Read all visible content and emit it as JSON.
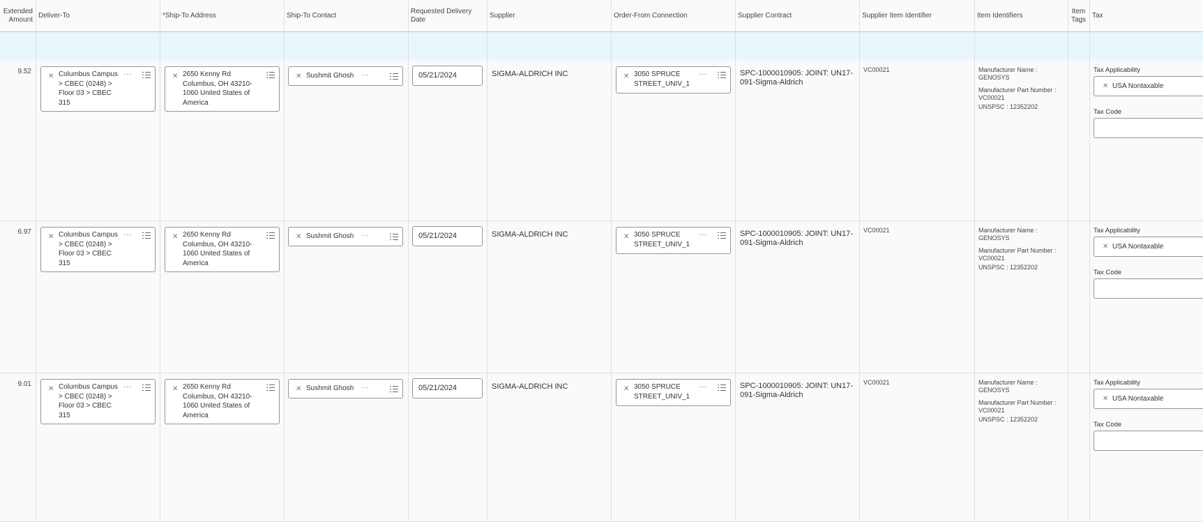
{
  "headers": {
    "extended_amount": "Extended Amount",
    "deliver_to": "Deliver-To",
    "ship_to_address": "*Ship-To Address",
    "ship_to_contact": "Ship-To Contact",
    "requested_delivery_date": "Requested Delivery Date",
    "supplier": "Supplier",
    "order_from_connection": "Order-From Connection",
    "supplier_contract": "Supplier Contract",
    "supplier_item_identifier": "Supplier Item Identifier",
    "item_identifiers": "Item Identifiers",
    "item_tags": "Item Tags",
    "tax": "Tax"
  },
  "rows": [
    {
      "amount": "9.52",
      "deliver_to": "Columbus Campus > CBEC (0248) > Floor 03 > CBEC 315",
      "ship_to_address": "2650 Kenny Rd Columbus, OH 43210-1060 United States of America",
      "ship_to_contact": "Sushmit Ghosh",
      "delivery_date": "05/21/2024",
      "supplier": "SIGMA-ALDRICH INC",
      "order_from": "3050 SPRUCE STREET_UNIV_1",
      "contract": "SPC-1000010905: JOINT: UN17-091-Sigma-Aldrich",
      "supplier_item_id": "VC00021",
      "mfr_name": "Manufacturer Name : GENOSYS",
      "mfr_part": "Manufacturer Part Number : VC00021",
      "unspsc": "UNSPSC : 12352202",
      "tax_applicability_label": "Tax Applicability",
      "tax_applicability": "USA Nontaxable",
      "tax_code_label": "Tax Code"
    },
    {
      "amount": "6.97",
      "deliver_to": "Columbus Campus > CBEC (0248) > Floor 03 > CBEC 315",
      "ship_to_address": "2650 Kenny Rd Columbus, OH 43210-1060 United States of America",
      "ship_to_contact": "Sushmit Ghosh",
      "delivery_date": "05/21/2024",
      "supplier": "SIGMA-ALDRICH INC",
      "order_from": "3050 SPRUCE STREET_UNIV_1",
      "contract": "SPC-1000010905: JOINT: UN17-091-Sigma-Aldrich",
      "supplier_item_id": "VC00021",
      "mfr_name": "Manufacturer Name : GENOSYS",
      "mfr_part": "Manufacturer Part Number : VC00021",
      "unspsc": "UNSPSC : 12352202",
      "tax_applicability_label": "Tax Applicability",
      "tax_applicability": "USA Nontaxable",
      "tax_code_label": "Tax Code"
    },
    {
      "amount": "9.01",
      "deliver_to": "Columbus Campus > CBEC (0248) > Floor 03 > CBEC 315",
      "ship_to_address": "2650 Kenny Rd Columbus, OH 43210-1060 United States of America",
      "ship_to_contact": "Sushmit Ghosh",
      "delivery_date": "05/21/2024",
      "supplier": "SIGMA-ALDRICH INC",
      "order_from": "3050 SPRUCE STREET_UNIV_1",
      "contract": "SPC-1000010905: JOINT: UN17-091-Sigma-Aldrich",
      "supplier_item_id": "VC00021",
      "mfr_name": "Manufacturer Name : GENOSYS",
      "mfr_part": "Manufacturer Part Number : VC00021",
      "unspsc": "UNSPSC : 12352202",
      "tax_applicability_label": "Tax Applicability",
      "tax_applicability": "USA Nontaxable",
      "tax_code_label": "Tax Code"
    }
  ]
}
